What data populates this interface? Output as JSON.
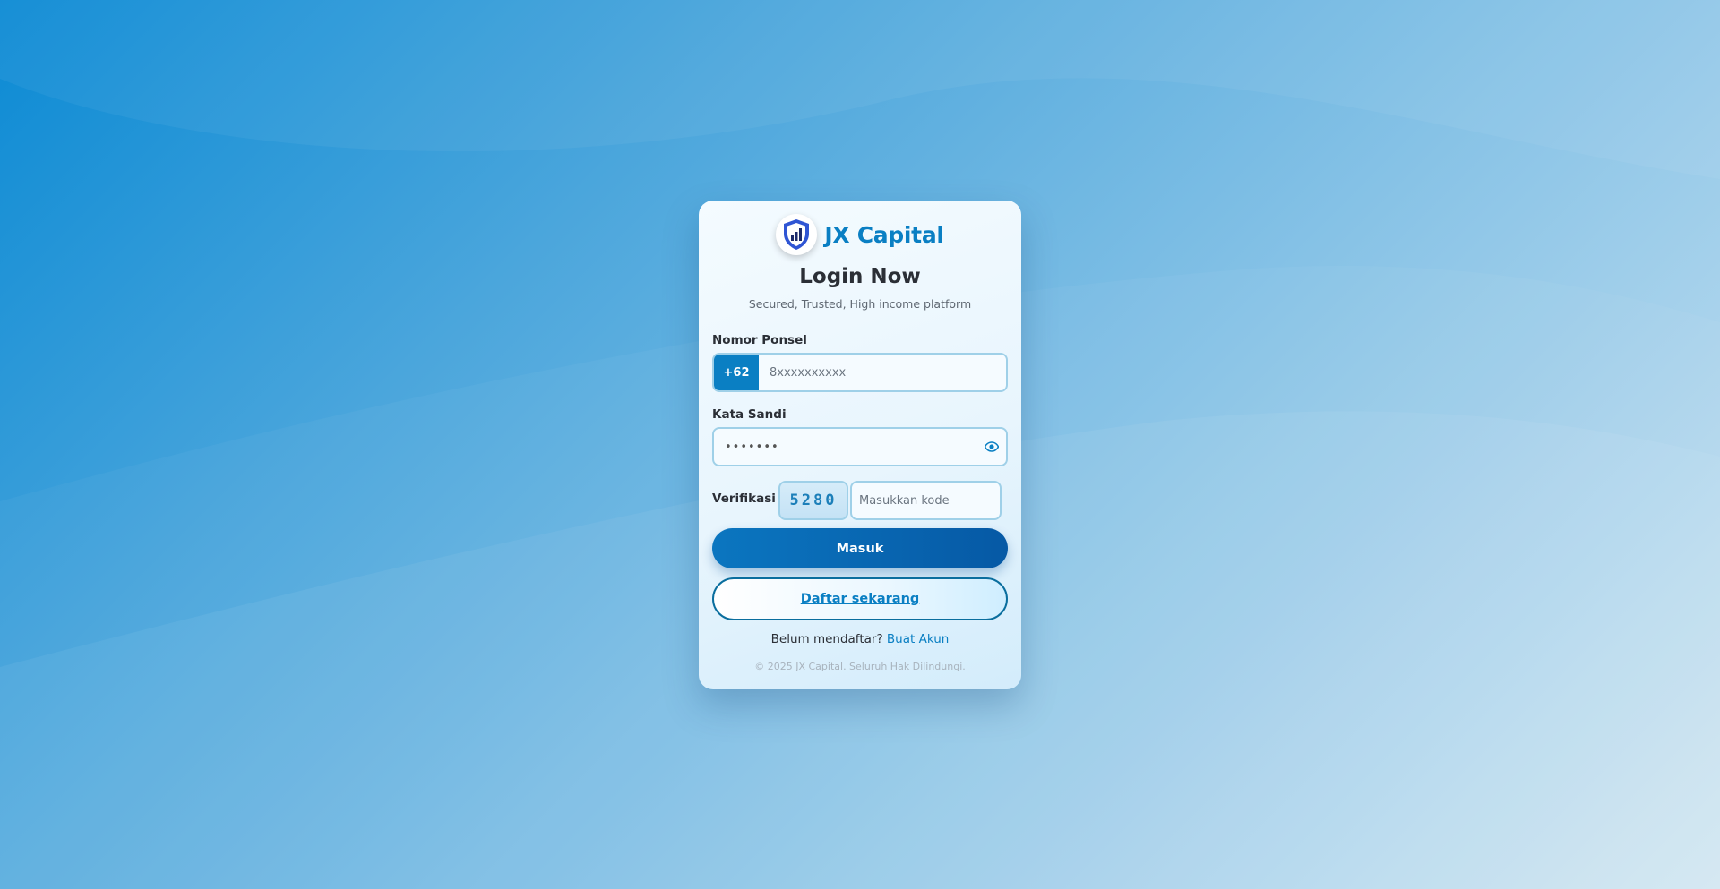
{
  "brand": {
    "name": "JX Capital",
    "logo_icon": "shield-chart-icon"
  },
  "header": {
    "title": "Login Now",
    "subtitle": "Secured, Trusted, High income platform"
  },
  "form": {
    "phone": {
      "label": "Nomor Ponsel",
      "country_code": "+62",
      "placeholder": "8xxxxxxxxxx",
      "value": ""
    },
    "password": {
      "label": "Kata Sandi",
      "value": "•••••••",
      "toggle_icon": "eye-icon"
    },
    "verification": {
      "label": "Verifikasi",
      "captcha": "5280",
      "placeholder": "Masukkan kode",
      "value": ""
    }
  },
  "actions": {
    "login_label": "Masuk",
    "register_label": "Daftar sekarang"
  },
  "footer": {
    "signup_prompt": "Belum mendaftar?",
    "signup_link": "Buat Akun",
    "copyright": "© 2025 JX Capital. Seluruh Hak Dilindungi."
  },
  "colors": {
    "primary": "#0a7fc3",
    "primary_dark": "#0659a5",
    "text": "#2b2f36",
    "border": "#9fd0e8"
  }
}
